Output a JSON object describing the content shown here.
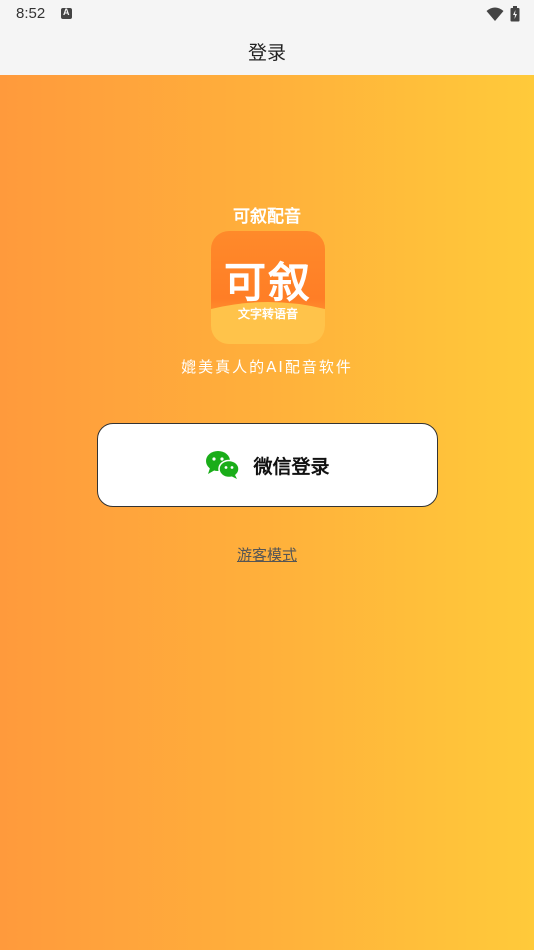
{
  "status_bar": {
    "time": "8:52"
  },
  "header": {
    "title": "登录"
  },
  "app": {
    "name": "可叙配音",
    "logo_main": "可叙",
    "logo_sub": "文字转语音",
    "tagline": "媲美真人的AI配音软件"
  },
  "login": {
    "wechat_label": "微信登录",
    "guest_label": "游客模式"
  },
  "colors": {
    "gradient_start": "#ff9a3c",
    "gradient_end": "#ffca3a",
    "wechat_green": "#1aad19"
  },
  "icons": [
    "wechat-icon",
    "wifi-icon",
    "battery-icon",
    "notification-a-icon"
  ]
}
